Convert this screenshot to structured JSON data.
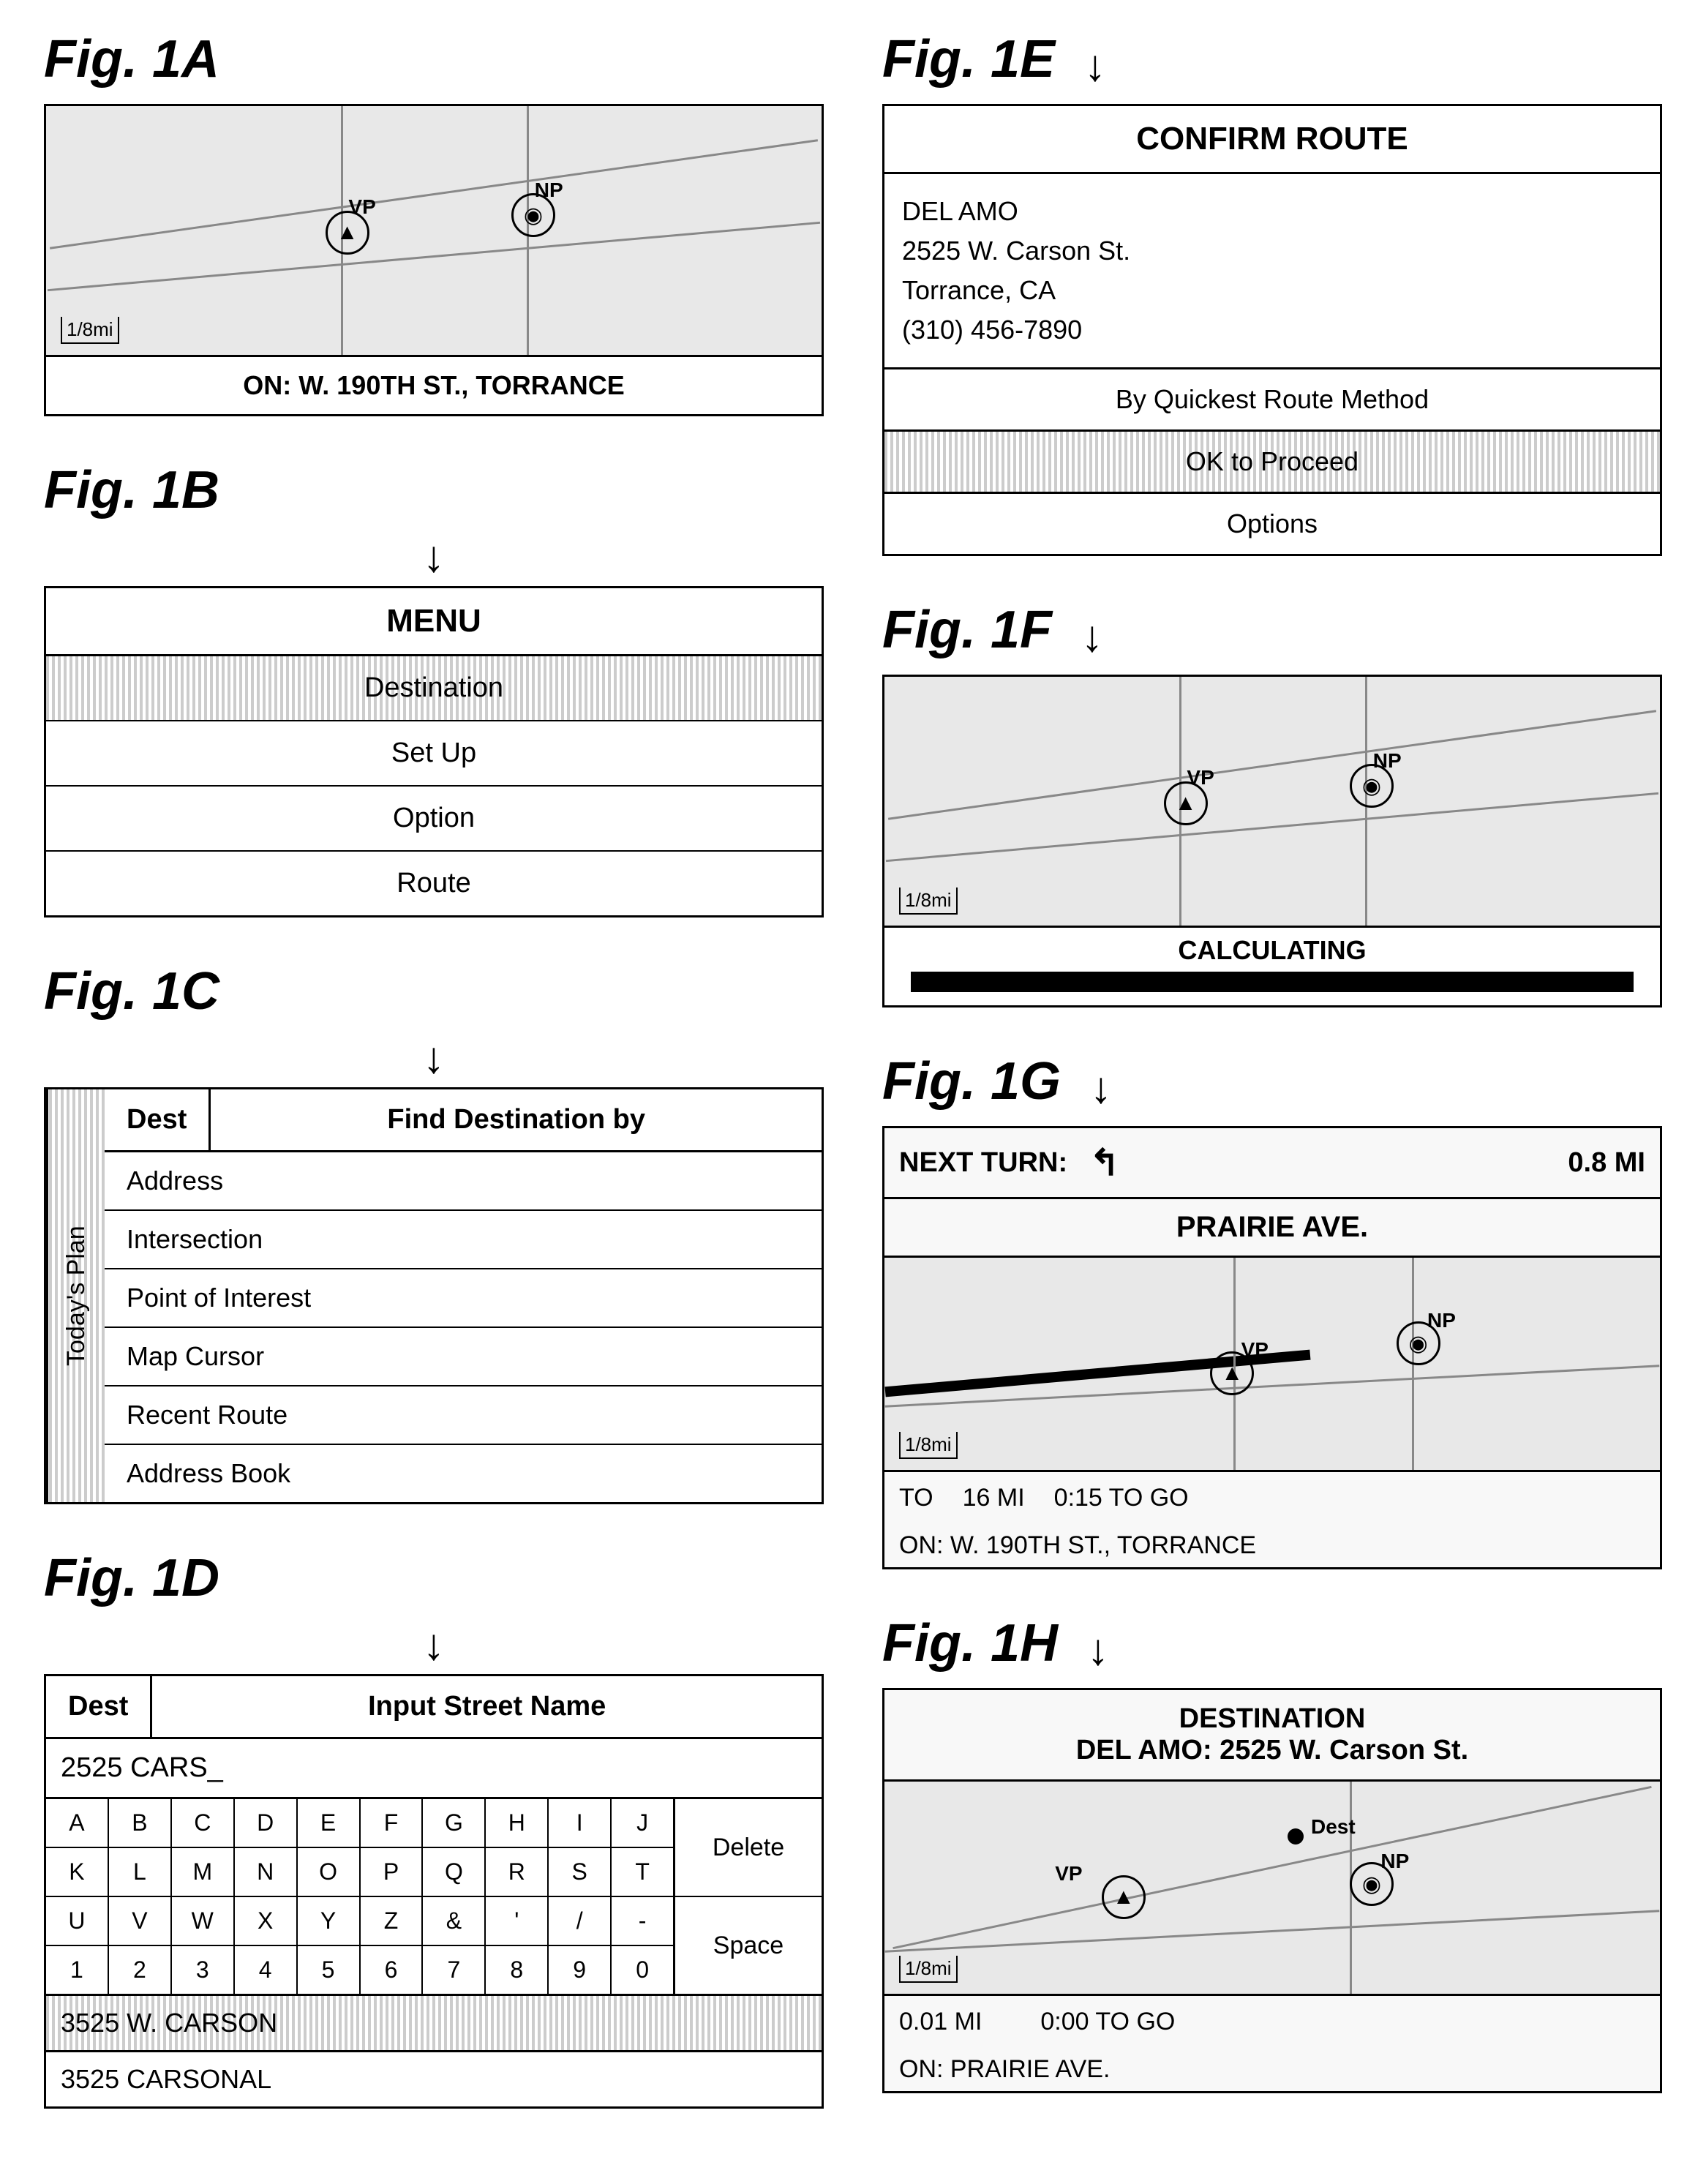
{
  "figures": {
    "fig1a": {
      "label": "Fig. 1A",
      "status": "ON: W. 190TH ST., TORRANCE",
      "scale": "1/8mi",
      "vp": "VP",
      "np": "NP"
    },
    "fig1b": {
      "label": "Fig. 1B",
      "arrow": "↓",
      "menu_header": "MENU",
      "items": [
        "Destination",
        "Set Up",
        "Option",
        "Route"
      ]
    },
    "fig1c": {
      "label": "Fig. 1C",
      "arrow": "↓",
      "tab_dest": "Dest",
      "header": "Find Destination by",
      "today_plan": "Today's Plan",
      "items": [
        "Address",
        "Intersection",
        "Point of Interest",
        "Map Cursor",
        "Recent Route",
        "Address Book"
      ]
    },
    "fig1d": {
      "label": "Fig. 1D",
      "arrow": "↓",
      "tab_dest": "Dest",
      "header": "Input Street Name",
      "input_value": "2525 CARS_",
      "keyboard": [
        [
          "A",
          "B",
          "C",
          "D",
          "E",
          "F",
          "G",
          "H",
          "I",
          "J"
        ],
        [
          "K",
          "L",
          "M",
          "N",
          "O",
          "P",
          "Q",
          "R",
          "S",
          "T"
        ],
        [
          "U",
          "V",
          "W",
          "X",
          "Y",
          "Z",
          "&",
          "'",
          "/",
          "-"
        ],
        [
          "1",
          "2",
          "3",
          "4",
          "5",
          "6",
          "7",
          "8",
          "9",
          "0"
        ]
      ],
      "key_delete": "Delete",
      "key_space": "Space",
      "suggestion_highlighted": "3525 W. CARSON",
      "suggestion_normal": "3525 CARSONAL"
    },
    "fig1e": {
      "label": "Fig. 1E",
      "arrow": "↓",
      "confirm_header": "CONFIRM ROUTE",
      "address_line1": "DEL AMO",
      "address_line2": "2525 W. Carson St.",
      "address_line3": "Torrance, CA",
      "address_line4": "(310) 456-7890",
      "route_method": "By Quickest Route Method",
      "ok_proceed": "OK to Proceed",
      "options": "Options"
    },
    "fig1f": {
      "label": "Fig. 1F",
      "arrow": "↓",
      "status": "CALCULATING",
      "scale": "1/8mi",
      "vp": "VP",
      "np": "NP"
    },
    "fig1g": {
      "label": "Fig. 1G",
      "arrow": "↓",
      "next_turn_label": "NEXT TURN:",
      "turn_distance": "0.8 MI",
      "street_name": "PRAIRIE AVE.",
      "scale": "1/8mi",
      "vp": "VP",
      "np": "NP",
      "to_label": "TO",
      "to_distance": "16 MI",
      "to_go": "0:15 TO GO",
      "on_label": "ON: W. 190TH ST., TORRANCE"
    },
    "fig1h": {
      "label": "Fig. 1H",
      "arrow": "↓",
      "dest_header1": "DESTINATION",
      "dest_header2": "DEL AMO: 2525 W. Carson St.",
      "dest_label": "Dest",
      "scale": "1/8mi",
      "vp": "VP",
      "np": "NP",
      "distance": "0.01 MI",
      "time_go": "0:00 TO GO",
      "on_label": "ON: PRAIRIE AVE."
    }
  }
}
